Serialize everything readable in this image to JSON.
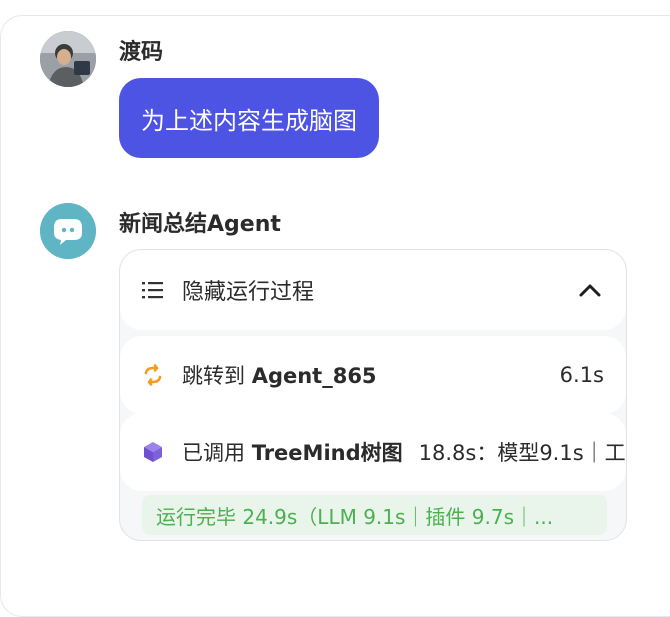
{
  "user": {
    "name": "渡码",
    "message": "为上述内容生成脑图"
  },
  "agent": {
    "name": "新闻总结Agent"
  },
  "process": {
    "toggle_label": "隐藏运行过程",
    "steps": [
      {
        "prefix": "跳转到 ",
        "target": "Agent_865",
        "time": "6.1s",
        "icon": "swap-icon"
      },
      {
        "prefix": "已调用 ",
        "target": "TreeMind树图",
        "meta": "18.8s：模型9.1s｜工",
        "icon": "cube-icon"
      }
    ],
    "summary": "运行完毕 24.9s（LLM 9.1s｜插件 9.7s｜..."
  },
  "colors": {
    "bubble": "#4d54e3",
    "success": "#4caf50",
    "agent_avatar": "#5fb5c4",
    "swap_icon": "#f59a23",
    "cube_icon": "#7b5bd6"
  }
}
